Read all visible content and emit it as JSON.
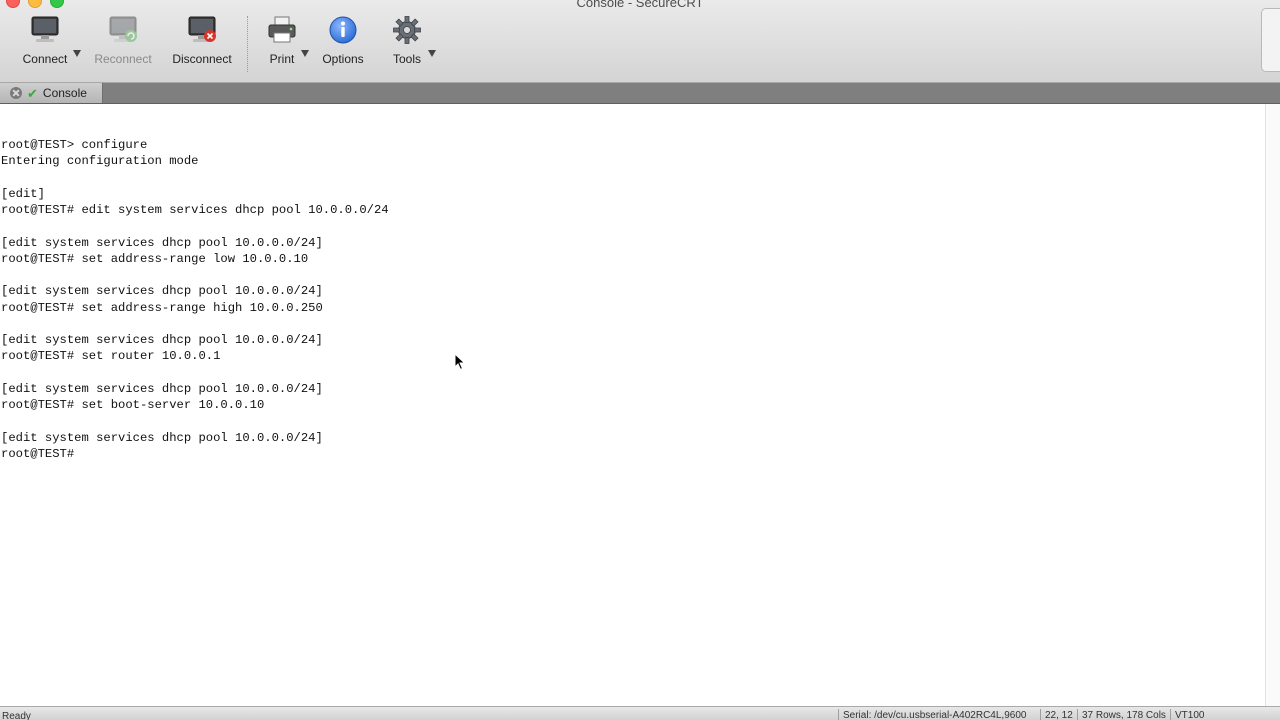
{
  "window": {
    "title": "Console - SecureCRT"
  },
  "toolbar": {
    "connect_label": "Connect",
    "reconnect_label": "Reconnect",
    "disconnect_label": "Disconnect",
    "print_label": "Print",
    "options_label": "Options",
    "tools_label": "Tools"
  },
  "tab": {
    "label": "Console",
    "status": "connected"
  },
  "terminal": {
    "lines": [
      "root@TEST> configure",
      "Entering configuration mode",
      "",
      "[edit]",
      "root@TEST# edit system services dhcp pool 10.0.0.0/24",
      "",
      "[edit system services dhcp pool 10.0.0.0/24]",
      "root@TEST# set address-range low 10.0.0.10",
      "",
      "[edit system services dhcp pool 10.0.0.0/24]",
      "root@TEST# set address-range high 10.0.0.250",
      "",
      "[edit system services dhcp pool 10.0.0.0/24]",
      "root@TEST# set router 10.0.0.1",
      "",
      "[edit system services dhcp pool 10.0.0.0/24]",
      "root@TEST# set boot-server 10.0.0.10",
      "",
      "[edit system services dhcp pool 10.0.0.0/24]",
      "root@TEST#"
    ]
  },
  "statusbar": {
    "ready": "Ready",
    "serial": "Serial: /dev/cu.usbserial-A402RC4L,9600",
    "position": "22, 12",
    "size": "37 Rows, 178 Cols",
    "emulation": "VT100"
  },
  "colors": {
    "connected_check": "#3aa83a",
    "options_blue": "#2f6fd6",
    "disconnect_red": "#d9342b"
  },
  "icons": {
    "connect": "computer-icon",
    "reconnect": "computer-refresh-icon",
    "disconnect": "computer-disconnect-icon",
    "print": "printer-icon",
    "options": "info-icon",
    "tools": "gear-icon"
  }
}
